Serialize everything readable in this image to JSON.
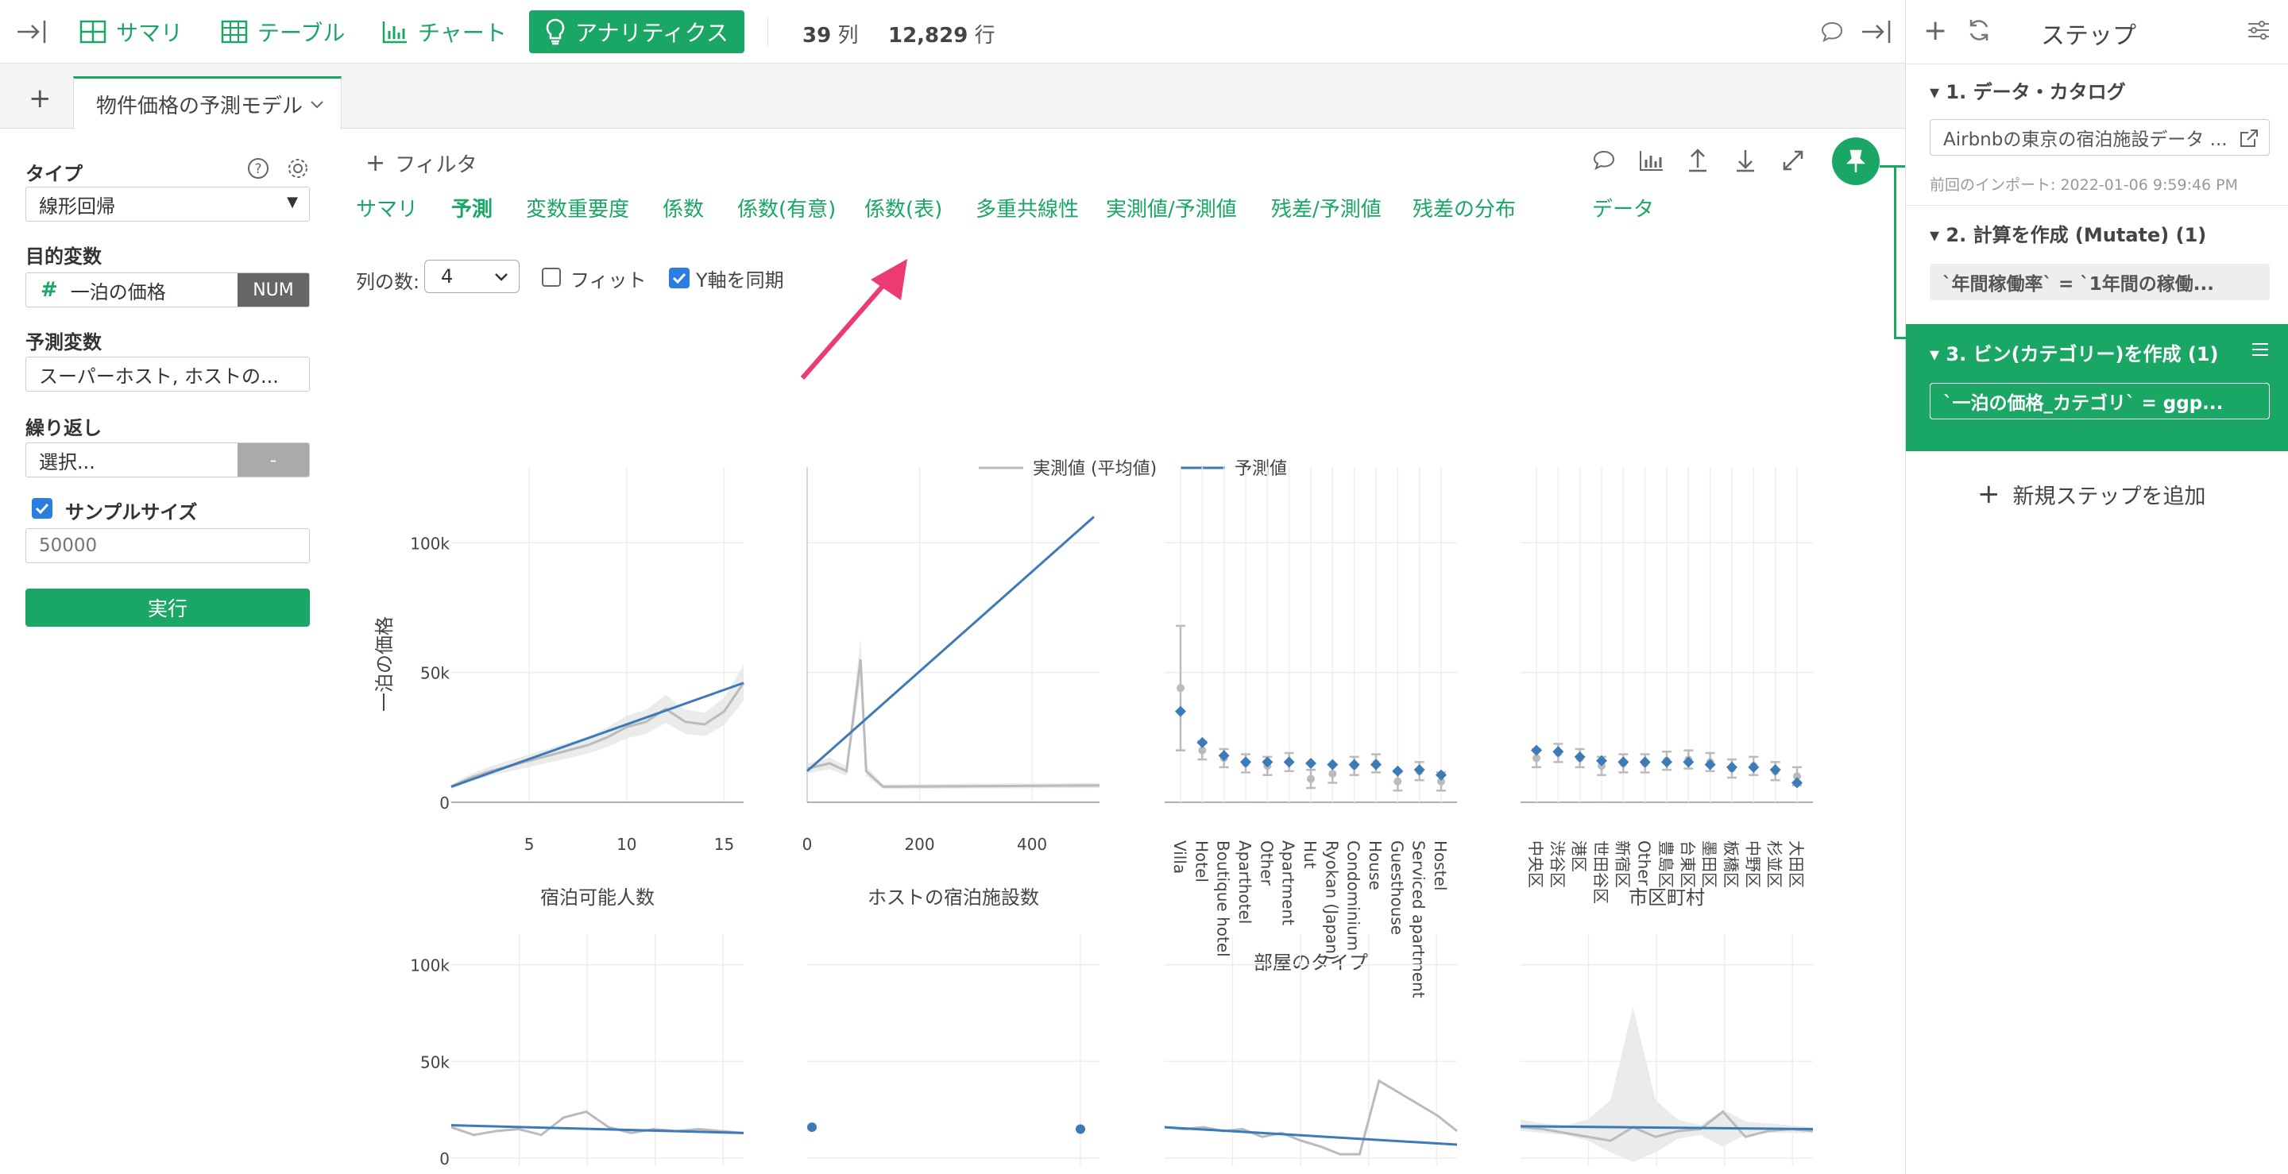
{
  "topbar": {
    "nav": [
      {
        "label": "サマリ",
        "icon": "summary-grid-icon"
      },
      {
        "label": "テーブル",
        "icon": "table-icon"
      },
      {
        "label": "チャート",
        "icon": "bar-chart-icon"
      },
      {
        "label": "アナリティクス",
        "icon": "lightbulb-icon"
      }
    ],
    "columns_count": "39",
    "columns_label": "列",
    "rows_count": "12,829",
    "rows_label": "行"
  },
  "tabs": {
    "active": "物件価格の予測モデル"
  },
  "left_panel": {
    "type_label": "タイプ",
    "type_value": "線形回帰",
    "target_label": "目的変数",
    "target_value": "一泊の価格",
    "target_type": "NUM",
    "predictor_label": "予測変数",
    "predictor_value": "スーパーホスト, ホストの...",
    "repeat_label": "繰り返し",
    "repeat_value": "選択...",
    "repeat_button": "-",
    "sample_label": "サンプルサイズ",
    "sample_placeholder": "50000",
    "run_button": "実行"
  },
  "main": {
    "filter_label": "フィルタ",
    "subtabs": [
      "サマリ",
      "予測",
      "変数重要度",
      "係数",
      "係数(有意)",
      "係数(表)",
      "多重共線性",
      "実測値/予測値",
      "残差/予測値",
      "残差の分布",
      "データ"
    ],
    "active_subtab": "予測",
    "cols_label": "列の数:",
    "cols_value": "4",
    "fit_label": "フィット",
    "sync_y_label": "Y軸を同期"
  },
  "chart_data": [
    {
      "type": "line",
      "legend": [
        "実測値 (平均値)",
        "予測値"
      ],
      "ylabel": "一泊の価格",
      "xlabel": "宿泊可能人数",
      "y_ticks": [
        "0",
        "50k",
        "100k"
      ],
      "x_ticks": [
        "5",
        "10",
        "15"
      ],
      "xlim": [
        1,
        16
      ],
      "ylim": [
        0,
        100000
      ],
      "series": [
        {
          "name": "実測値 (平均値)",
          "x": [
            1,
            2,
            3,
            4,
            5,
            6,
            7,
            8,
            9,
            10,
            11,
            12,
            13,
            14,
            15,
            16
          ],
          "y": [
            6000,
            9500,
            12000,
            14000,
            16000,
            18000,
            20000,
            22000,
            25000,
            29000,
            31000,
            36000,
            31000,
            30000,
            35000,
            46000
          ]
        },
        {
          "name": "予測値",
          "x": [
            1,
            16
          ],
          "y": [
            6000,
            46000
          ]
        }
      ]
    },
    {
      "type": "line",
      "xlabel": "ホストの宿泊施設数",
      "x_ticks": [
        "0",
        "200",
        "400"
      ],
      "xlim": [
        0,
        520
      ],
      "ylim": [
        0,
        100000
      ],
      "series": [
        {
          "name": "実測値 (平均値)",
          "x": [
            0,
            40,
            70,
            95,
            105,
            135,
            520
          ],
          "y": [
            13000,
            15000,
            12000,
            55000,
            12000,
            6000,
            6500
          ]
        },
        {
          "name": "予測値",
          "x": [
            0,
            510
          ],
          "y": [
            12000,
            110000
          ]
        }
      ]
    },
    {
      "type": "scatter",
      "xlabel": "部屋のタイプ",
      "categories": [
        "Villa",
        "Hotel",
        "Boutique hotel",
        "Aparthotel",
        "Other",
        "Apartment",
        "Hut",
        "Ryokan (Japan)",
        "Condominium",
        "House",
        "Guesthouse",
        "Serviced apartment",
        "Hostel"
      ],
      "ylim": [
        0,
        100000
      ],
      "series": [
        {
          "name": "実測値 (平均値)",
          "values": [
            44000,
            20000,
            17000,
            15000,
            14000,
            15500,
            9000,
            11000,
            14000,
            15000,
            8000,
            12000,
            8000
          ]
        },
        {
          "name": "予測値",
          "values": [
            35000,
            23000,
            18000,
            15500,
            15500,
            15500,
            15000,
            14500,
            14500,
            14500,
            12000,
            12500,
            10500
          ]
        }
      ]
    },
    {
      "type": "scatter",
      "xlabel": "市区町村",
      "categories": [
        "中央区",
        "渋谷区",
        "港区",
        "世田谷区",
        "新宿区",
        "Other",
        "豊島区",
        "台東区",
        "墨田区",
        "板橋区",
        "中野区",
        "杉並区",
        "大田区"
      ],
      "ylim": [
        0,
        100000
      ],
      "series": [
        {
          "name": "実測値 (平均値)",
          "values": [
            17000,
            19000,
            17000,
            14000,
            15000,
            15000,
            16000,
            16500,
            15500,
            13000,
            14000,
            12000,
            10000
          ]
        },
        {
          "name": "予測値",
          "values": [
            20000,
            19500,
            17500,
            16000,
            15500,
            15500,
            15500,
            15500,
            14500,
            13500,
            13500,
            12500,
            7500
          ]
        }
      ]
    }
  ],
  "lower_charts": {
    "y_ticks": [
      "0",
      "50k",
      "100k"
    ]
  },
  "right_panel": {
    "title": "ステップ",
    "steps": [
      {
        "title": "1. データ・カタログ",
        "chip": "Airbnbの東京の宿泊施設データ ...",
        "meta": "前回のインポート: 2022-01-06 9:59:46 PM"
      },
      {
        "title": "2. 計算を作成 (Mutate) (1)",
        "chip": "`年間稼働率` = `1年間の稼働..."
      },
      {
        "title": "3. ビン(カテゴリー)を作成 (1)",
        "chip": "`一泊の価格_カテゴリ` = ggp..."
      }
    ],
    "add_step": "新規ステップを追加"
  },
  "colors": {
    "accent": "#1aa766",
    "predicted": "#3d7ab8",
    "actual": "#bbbbbb",
    "arrow": "#ee3a72"
  }
}
